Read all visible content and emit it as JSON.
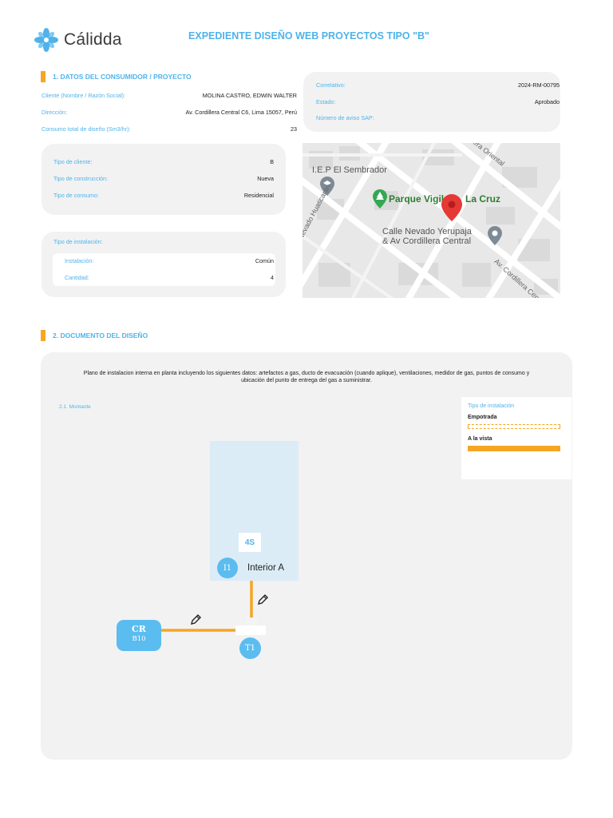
{
  "header": {
    "brand": "Cálidda",
    "title": "EXPEDIENTE DISEÑO WEB PROYECTOS TIPO \"B\""
  },
  "section1": {
    "title": "1. DATOS DEL CONSUMIDOR / PROYECTO",
    "client_label": "Cliente (Nombre / Razón Social):",
    "client_value": "MOLINA CASTRO, EDWIN WALTER",
    "address_label": "Dirección:",
    "address_value": "Av. Cordillera Central C6, Lima 15057, Perú",
    "consumption_label": "Consumo total de diseño (Sm3/hr):",
    "consumption_value": "23"
  },
  "status_card": {
    "correlativo_label": "Correlativo:",
    "correlativo_value": "2024-RM-00795",
    "estado_label": "Estado:",
    "estado_value": "Aprobado",
    "aviso_label": "Número de aviso SAP:",
    "aviso_value": ""
  },
  "client_card": {
    "tipo_cliente_label": "Tipo de cliente:",
    "tipo_cliente_value": "B",
    "tipo_construccion_label": "Tipo de construcción:",
    "tipo_construccion_value": "Nueva",
    "tipo_consumo_label": "Tipo de consumo:",
    "tipo_consumo_value": "Residencial"
  },
  "install_card": {
    "title": "Tipo de instalación:",
    "instalacion_label": "Instalación:",
    "instalacion_value": "Común",
    "cantidad_label": "Cantidad:",
    "cantidad_value": "4"
  },
  "map": {
    "place_school": "I.E.P El Sembrador",
    "place_park": "Parque Vigil",
    "place_park_tail": "La Cruz",
    "place_corner_1": "Calle Nevado Yerupaja",
    "place_corner_2": "& Av Cordillera Central",
    "street_left": "Nevado Huascarán",
    "street_right": "Av. Cordillera Cen",
    "street_top": "era Oriental",
    "colors": {
      "park_pin": "#34a853",
      "main_pin": "#e53935",
      "poi_pin": "#7d8a96"
    }
  },
  "section2": {
    "title": "2. DOCUMENTO DEL DISEÑO",
    "description": "Plano de instalacion interna en planta incluyendo los siguientes datos: artefactos a gas, ducto de evacuación (cuando aplique), ventilaciones, medidor de gas, puntos de consumo y ubicación del punto de entrega del gas a suministrar.",
    "subsection": "2.1. Montante"
  },
  "legend": {
    "title": "Tipo de instalación",
    "embedded_label": "Empotrada",
    "visible_label": "A la vista",
    "line_color": "#f5a623"
  },
  "diagram": {
    "unit_number": "4S",
    "interior_badge": "I1",
    "interior_label": "Interior A",
    "cr_badge_line1": "CR",
    "cr_badge_line2": "B10",
    "t_badge": "T1",
    "colors": {
      "badge": "#5bbcf0",
      "room_fill": "#dcecf7",
      "pipe": "#f5a623"
    }
  }
}
